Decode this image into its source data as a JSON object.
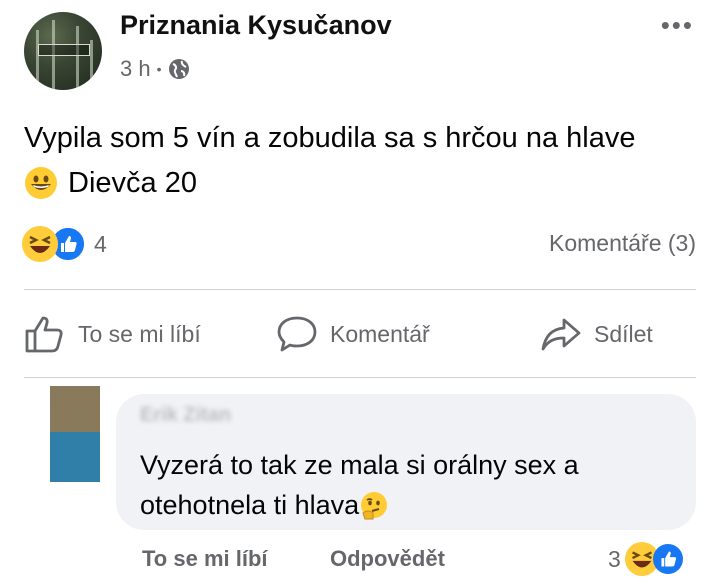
{
  "post": {
    "page_name": "Priznania Kysučanov",
    "time": "3 h",
    "separator": "•",
    "privacy_icon": "globe-icon",
    "more_icon": "more-options-icon",
    "text_line1": "Vypila som 5 vín a zobudila sa s hrčou na hlave",
    "text_line2": "Dievča 20",
    "reaction_count": "4",
    "comments_label": "Komentáře (3)"
  },
  "actions": {
    "like_label": "To se mi líbí",
    "comment_label": "Komentář",
    "share_label": "Sdílet"
  },
  "comment": {
    "author": "Erik Zitan",
    "text_line1": "Vyzerá to tak ze mala si orálny sex a",
    "text_line2": "otehotnela ti hlava",
    "like_label": "To se mi líbí",
    "reply_label": "Odpovědět",
    "reaction_count": "3"
  },
  "colors": {
    "like_blue": "#1877f2",
    "haha_yellow": "#ffcd3c",
    "secondary_text": "#65676b",
    "bubble_bg": "#f0f2f5"
  }
}
